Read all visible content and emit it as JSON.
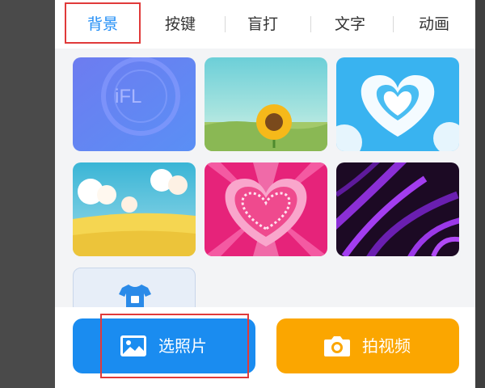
{
  "tabs": [
    {
      "label": "背景",
      "active": true
    },
    {
      "label": "按键",
      "active": false
    },
    {
      "label": "盲打",
      "active": false
    },
    {
      "label": "文字",
      "active": false
    },
    {
      "label": "动画",
      "active": false
    }
  ],
  "thumbnails": [
    {
      "name": "ifly-blue-gradient",
      "logo_text": "iFL"
    },
    {
      "name": "sunflower-field"
    },
    {
      "name": "cloud-heart-sky"
    },
    {
      "name": "yellow-field-clouds"
    },
    {
      "name": "pink-heart-burst"
    },
    {
      "name": "purple-feathers"
    }
  ],
  "custom_item": {
    "icon": "tshirt-icon"
  },
  "actions": {
    "photo_label": "选照片",
    "photo_icon": "image-icon",
    "video_label": "拍视频",
    "video_icon": "camera-icon"
  },
  "colors": {
    "accent": "#1e8cf5",
    "photo_button": "#1a8cf0",
    "video_button": "#fba600",
    "highlight_box": "#e03a3a"
  }
}
